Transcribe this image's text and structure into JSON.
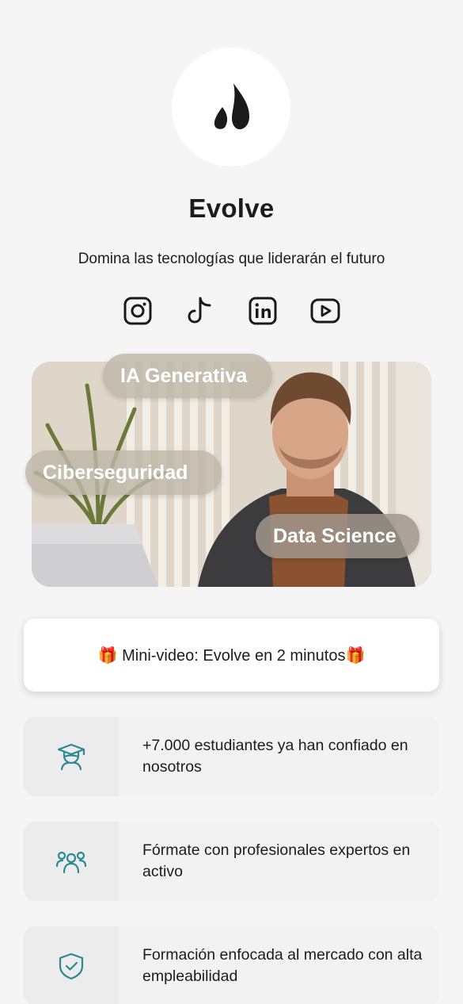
{
  "profile": {
    "name": "Evolve",
    "tagline": "Domina las tecnologías que liderarán el futuro",
    "logo_icon": "evolve-flame-logo"
  },
  "socials": [
    {
      "name": "instagram",
      "icon": "instagram-icon"
    },
    {
      "name": "tiktok",
      "icon": "tiktok-icon"
    },
    {
      "name": "linkedin",
      "icon": "linkedin-icon"
    },
    {
      "name": "youtube",
      "icon": "youtube-icon"
    }
  ],
  "hero": {
    "tags": [
      "IA Generativa",
      "Ciberseguridad",
      "Data Science"
    ]
  },
  "cta": {
    "label": "🎁 Mini-video: Evolve en 2 minutos🎁"
  },
  "features": [
    {
      "icon": "graduate-icon",
      "text": "+7.000 estudiantes ya han confiado en nosotros"
    },
    {
      "icon": "team-icon",
      "text": "Fórmate con profesionales expertos en activo"
    },
    {
      "icon": "shield-check-icon",
      "text": "Formación enfocada al mercado con alta empleabilidad"
    }
  ],
  "colors": {
    "accent": "#2a8a8f",
    "background": "#f5f5f5",
    "text": "#1c1c1c"
  }
}
